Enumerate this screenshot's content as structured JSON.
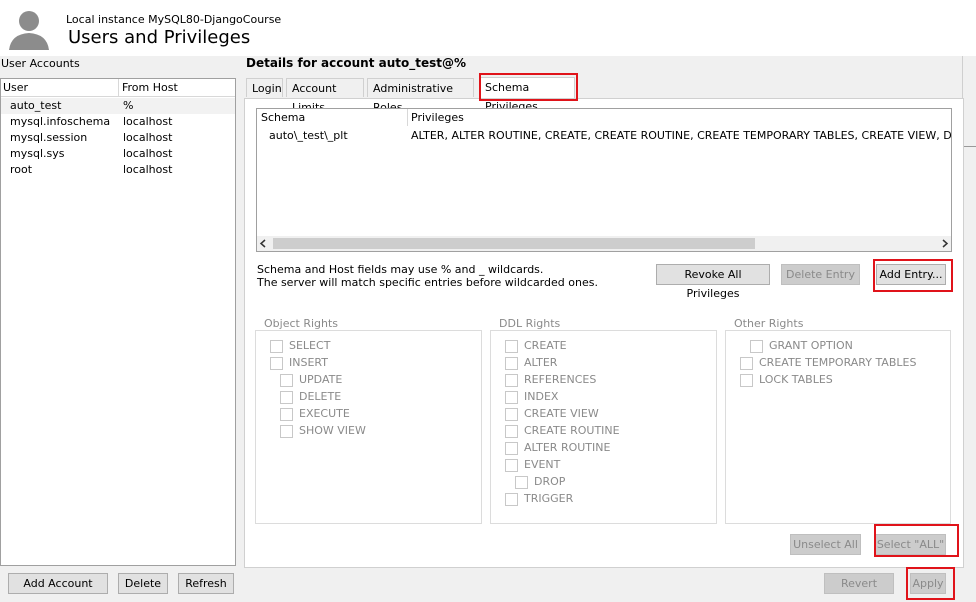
{
  "header": {
    "instance": "Local instance MySQL80-DjangoCourse",
    "title": "Users and Privileges"
  },
  "user_accounts": {
    "label": "User Accounts",
    "columns": [
      "User",
      "From Host"
    ],
    "rows": [
      {
        "user": "auto_test",
        "host": "%"
      },
      {
        "user": "mysql.infoschema",
        "host": "localhost"
      },
      {
        "user": "mysql.session",
        "host": "localhost"
      },
      {
        "user": "mysql.sys",
        "host": "localhost"
      },
      {
        "user": "root",
        "host": "localhost"
      }
    ],
    "buttons": {
      "add": "Add Account",
      "delete": "Delete",
      "refresh": "Refresh"
    }
  },
  "details": {
    "title": "Details for account auto_test@%",
    "tabs": [
      "Login",
      "Account Limits",
      "Administrative Roles",
      "Schema Privileges"
    ],
    "schema_table": {
      "columns": [
        "Schema",
        "Privileges"
      ],
      "rows": [
        {
          "schema": "auto\\_test\\_plt",
          "privileges": "ALTER, ALTER ROUTINE, CREATE, CREATE ROUTINE, CREATE TEMPORARY TABLES, CREATE VIEW, DELETE"
        }
      ]
    },
    "note": [
      "Schema and Host fields may use % and _ wildcards.",
      "The server will match specific entries before wildcarded ones."
    ],
    "buttons": {
      "revoke_all": "Revoke All Privileges",
      "delete_entry": "Delete Entry",
      "add_entry": "Add Entry...",
      "unselect_all": "Unselect All",
      "select_all": "Select \"ALL\"",
      "revert": "Revert",
      "apply": "Apply"
    },
    "object_rights": {
      "label": "Object Rights",
      "items": [
        "SELECT",
        "INSERT",
        "UPDATE",
        "DELETE",
        "EXECUTE",
        "SHOW VIEW"
      ]
    },
    "ddl_rights": {
      "label": "DDL Rights",
      "items": [
        "CREATE",
        "ALTER",
        "REFERENCES",
        "INDEX",
        "CREATE VIEW",
        "CREATE ROUTINE",
        "ALTER ROUTINE",
        "EVENT",
        "DROP",
        "TRIGGER"
      ]
    },
    "other_rights": {
      "label": "Other Rights",
      "items": [
        "GRANT OPTION",
        "CREATE TEMPORARY TABLES",
        "LOCK TABLES"
      ]
    }
  },
  "colors": {
    "highlight": "#e0131a",
    "disabled_text": "#8a8a8a"
  }
}
